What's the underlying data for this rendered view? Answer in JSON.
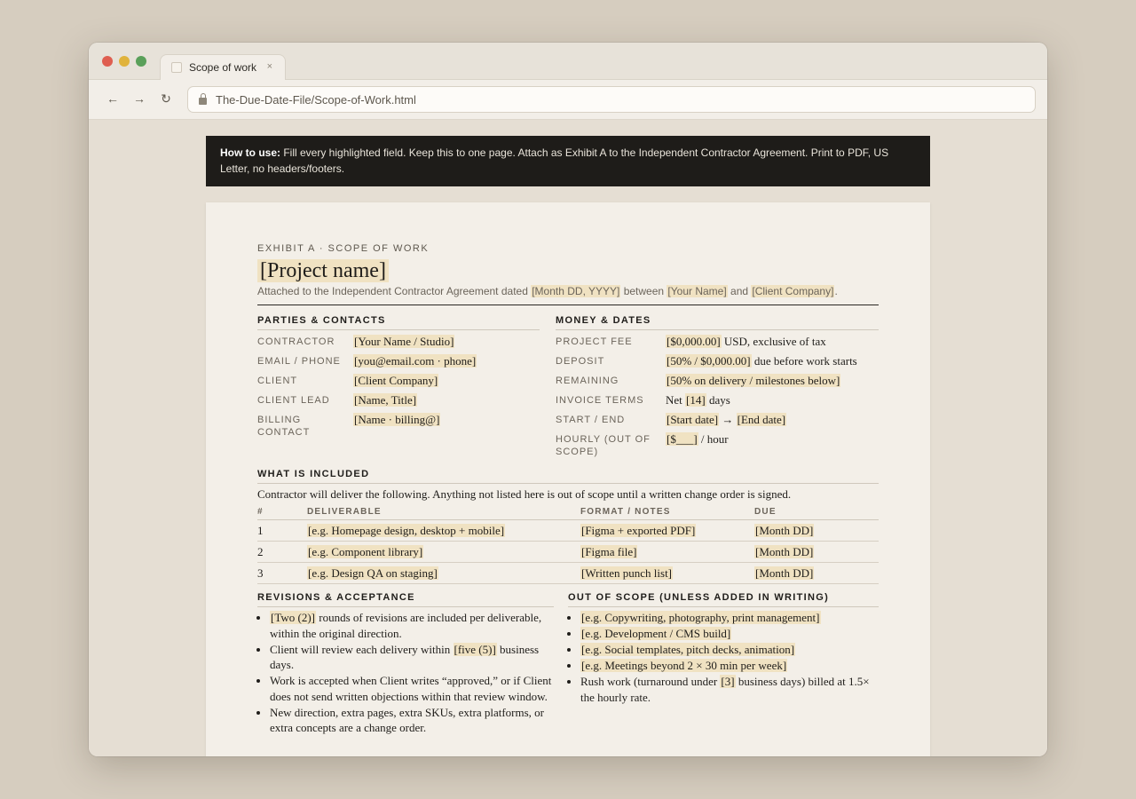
{
  "browser": {
    "tab_title": "Scope of work",
    "tab_close": "×",
    "back": "←",
    "forward": "→",
    "reload": "↻",
    "url": "The-Due-Date-File/Scope-of-Work.html"
  },
  "banner": {
    "label": "How to use:",
    "text": " Fill every highlighted field. Keep this to one page. Attach as Exhibit A to the Independent Contractor Agreement. Print to PDF, US Letter, no headers/footers."
  },
  "doc": {
    "eyebrow": "EXHIBIT A · SCOPE OF WORK",
    "title": "[Project name]",
    "subtitle": {
      "t1": "Attached to the Independent Contractor Agreement dated ",
      "date": "[Month DD, YYYY]",
      "t2": " between ",
      "party1": "[Your Name]",
      "t3": " and ",
      "party2": "[Client Company]",
      "t4": "."
    },
    "parties": {
      "heading": "PARTIES & CONTACTS",
      "rows": [
        {
          "k": "CONTRACTOR",
          "v": "[Your Name / Studio]"
        },
        {
          "k": "EMAIL / PHONE",
          "v": "[you@email.com · phone]"
        },
        {
          "k": "CLIENT",
          "v": "[Client Company]"
        },
        {
          "k": "CLIENT LEAD",
          "v": "[Name, Title]"
        },
        {
          "k": "BILLING CONTACT",
          "v": "[Name · billing@]"
        }
      ]
    },
    "money": {
      "heading": "MONEY & DATES",
      "fee": {
        "k": "PROJECT FEE",
        "v": "[$0,000.00]",
        "after": " USD, exclusive of tax"
      },
      "deposit": {
        "k": "DEPOSIT",
        "v": "[50% / $0,000.00]",
        "after": " due before work starts"
      },
      "remaining": {
        "k": "REMAINING",
        "v": "[50% on delivery / milestones below]"
      },
      "invoice": {
        "k": "INVOICE TERMS",
        "before": "Net ",
        "v": "[14]",
        "after": " days"
      },
      "startend": {
        "k": "START / END",
        "start": "[Start date]",
        "arrow": " → ",
        "end": "[End date]"
      },
      "hourly": {
        "k": "HOURLY (OUT OF SCOPE)",
        "v": "[$___]",
        "after": " / hour"
      }
    },
    "included": {
      "heading": "WHAT IS INCLUDED",
      "intro": "Contractor will deliver the following. Anything not listed here is out of scope until a written change order is signed.",
      "columns": [
        "#",
        "DELIVERABLE",
        "FORMAT / NOTES",
        "DUE"
      ],
      "rows": [
        {
          "n": "1",
          "deliverable": "[e.g. Homepage design, desktop + mobile]",
          "format": "[Figma + exported PDF]",
          "due": "[Month DD]"
        },
        {
          "n": "2",
          "deliverable": "[e.g. Component library]",
          "format": "[Figma file]",
          "due": "[Month DD]"
        },
        {
          "n": "3",
          "deliverable": "[e.g. Design QA on staging]",
          "format": "[Written punch list]",
          "due": "[Month DD]"
        }
      ]
    },
    "revisions": {
      "heading": "REVISIONS & ACCEPTANCE",
      "b1": {
        "hl": "[Two (2)]",
        "text": " rounds of revisions are included per deliverable, within the original direction."
      },
      "b2": {
        "before": "Client will review each delivery within ",
        "hl": "[five (5)]",
        "after": " business days."
      },
      "b3": "Work is accepted when Client writes “approved,” or if Client does not send written objections within that review window.",
      "b4": "New direction, extra pages, extra SKUs, extra platforms, or extra concepts are a change order."
    },
    "out_of_scope": {
      "heading": "OUT OF SCOPE (UNLESS ADDED IN WRITING)",
      "items": [
        "[e.g. Copywriting, photography, print management]",
        "[e.g. Development / CMS build]",
        "[e.g. Social templates, pitch decks, animation]",
        "[e.g. Meetings beyond 2 × 30 min per week]"
      ],
      "rush": {
        "before": "Rush work (turnaround under ",
        "hl": "[3]",
        "after": " business days) billed at 1.5× the hourly rate."
      }
    }
  }
}
